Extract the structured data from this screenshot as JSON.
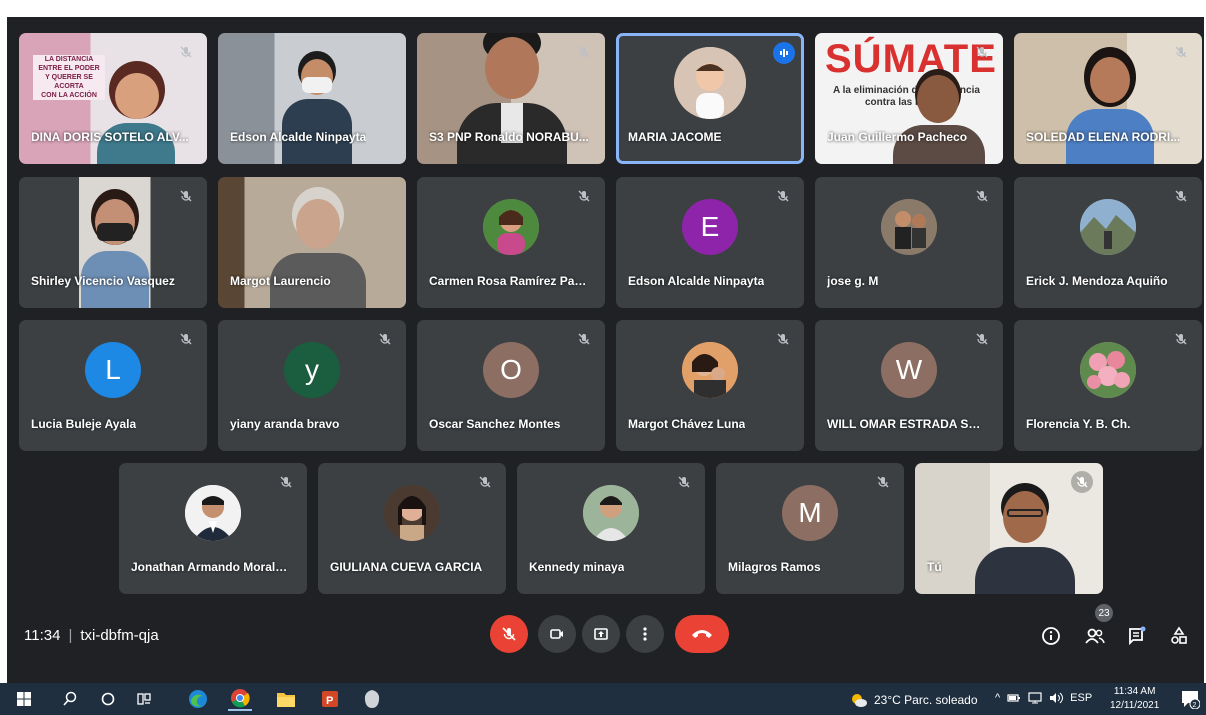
{
  "meeting": {
    "time": "11:34",
    "code": "txi-dbfm-qja",
    "participant_count": "23"
  },
  "poster_dina": {
    "text1": "LA DISTANCIA",
    "text2": "ENTRE EL PODER",
    "text3": "Y QUERER SE ACORTA",
    "text4": "CON LA ACCIÓN"
  },
  "poster_juan": {
    "title": "SÚMATE",
    "line1": "A la eliminación de la violencia",
    "line2": "contra las mujeres"
  },
  "tiles": [
    {
      "name": "DINA DORIS SOTELO ALV..."
    },
    {
      "name": "Edson Alcalde Ninpayta"
    },
    {
      "name": "S3 PNP Ronaldo NORABU..."
    },
    {
      "name": "MARIA JACOME"
    },
    {
      "name": "Juan Guillermo Pacheco"
    },
    {
      "name": "SOLEDAD ELENA RODRI..."
    },
    {
      "name": "Shirley Vicencio Vasquez"
    },
    {
      "name": "Margot Laurencio"
    },
    {
      "name": "Carmen Rosa Ramírez Pas..."
    },
    {
      "name": "Edson Alcalde Ninpayta",
      "initial": "E"
    },
    {
      "name": "jose g. M"
    },
    {
      "name": "Erick J. Mendoza Aquiño"
    },
    {
      "name": "Lucia Buleje Ayala",
      "initial": "L"
    },
    {
      "name": "yiany aranda bravo",
      "initial": "y"
    },
    {
      "name": "Oscar Sanchez Montes",
      "initial": "O"
    },
    {
      "name": "Margot Chávez Luna"
    },
    {
      "name": "WILL OMAR ESTRADA SAL...",
      "initial": "W"
    },
    {
      "name": "Florencia Y. B. Ch."
    },
    {
      "name": "Jonathan Armando Morale..."
    },
    {
      "name": "GIULIANA CUEVA GARCIA"
    },
    {
      "name": "Kennedy minaya"
    },
    {
      "name": "Milagros Ramos",
      "initial": "M"
    },
    {
      "name": "Tú"
    }
  ],
  "taskbar": {
    "weather": "23°C  Parc. soleado",
    "lang": "ESP",
    "time": "11:34 AM",
    "date": "12/11/2021",
    "notif_count": "2"
  },
  "colors": {
    "background": "#202124",
    "tile": "#3c4043",
    "speaking": "#8ab4f8",
    "end_call": "#ea4335",
    "avatar_E": "#8e24aa",
    "avatar_L": "#1e88e5",
    "avatar_y": "#1b5e3f",
    "avatar_O": "#8d6e63",
    "avatar_W": "#8d6e63",
    "avatar_M": "#8d6e63"
  }
}
